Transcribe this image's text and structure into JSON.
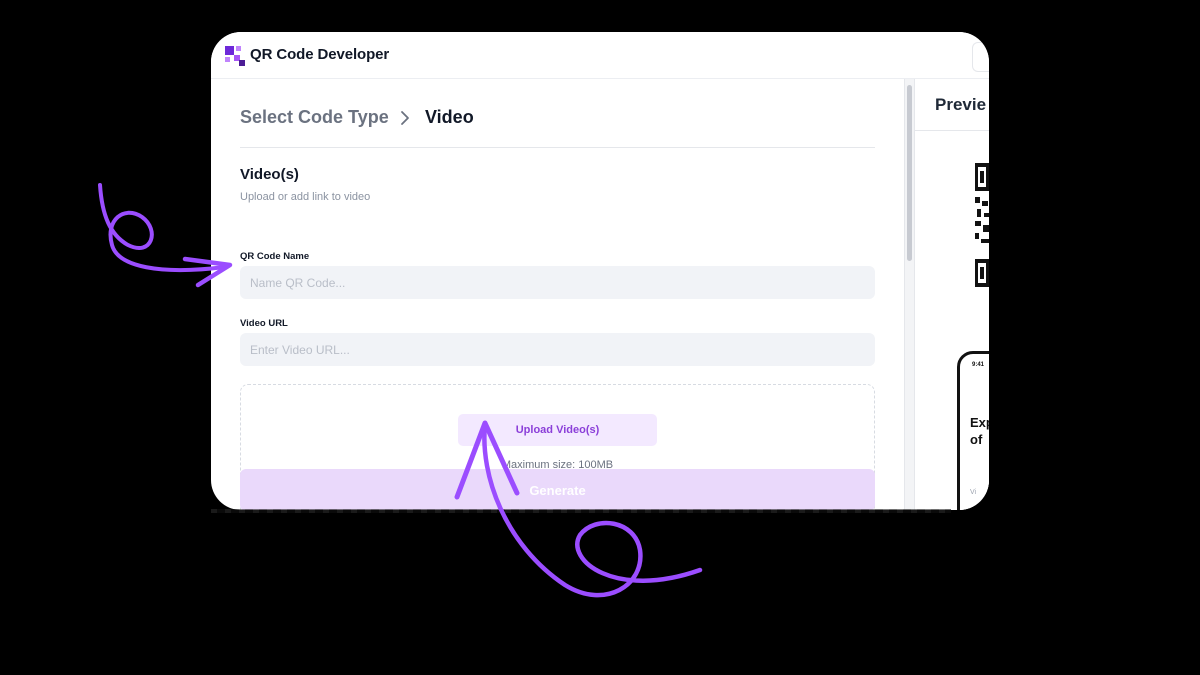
{
  "app": {
    "title": "QR Code Developer"
  },
  "breadcrumb": {
    "previous": "Select Code Type",
    "current": "Video"
  },
  "section": {
    "title": "Video(s)",
    "subtitle": "Upload or add link to video"
  },
  "fields": {
    "name_label": "QR Code Name",
    "name_placeholder": "Name QR Code...",
    "name_value": "",
    "url_label": "Video URL",
    "url_placeholder": "Enter Video URL...",
    "url_value": ""
  },
  "upload": {
    "button_label": "Upload Video(s)",
    "max_size": "Maximum size: 100MB"
  },
  "actions": {
    "generate_label": "Generate"
  },
  "preview": {
    "title": "Previe",
    "phone_time": "9:41",
    "phone_title": "Exp\nof",
    "phone_footer": "Vi"
  },
  "colors": {
    "accent": "#8b3fd9",
    "accent_light": "#f3e9ff",
    "generate_disabled": "#ead9fb",
    "annotation_arrow": "#9b4dff",
    "background": "#000000"
  }
}
